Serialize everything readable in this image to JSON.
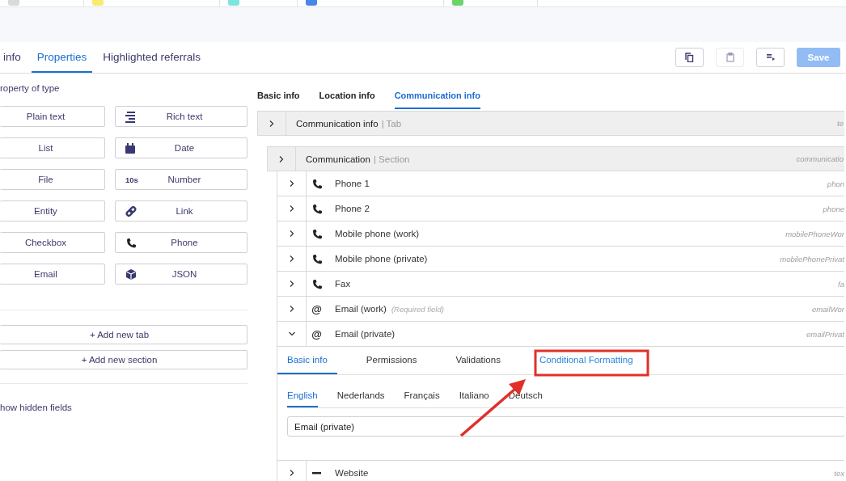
{
  "browser_tabs": [
    {
      "color": "#d9d9d9"
    },
    {
      "color": "#f7ec6e"
    },
    {
      "color": "#7fe3e0"
    },
    {
      "color": "#4a86e8"
    },
    {
      "color": "#6ad46a"
    }
  ],
  "page_tabs": [
    {
      "label": "info",
      "selected": false
    },
    {
      "label": "Properties",
      "selected": true
    },
    {
      "label": "Highlighted referrals",
      "selected": false
    }
  ],
  "toolbar": {
    "buttons": [
      {
        "kind": "copy",
        "disabled": false
      },
      {
        "kind": "paste",
        "disabled": true
      },
      {
        "kind": "format",
        "disabled": false
      }
    ],
    "save": {
      "label": "Save",
      "disabled": true
    }
  },
  "left_panel": {
    "heading": "roperty of type",
    "property_types": [
      {
        "label": "Plain text"
      },
      {
        "label": "Rich text",
        "kind": "lines"
      },
      {
        "label": "List"
      },
      {
        "label": "Date",
        "kind": "calendar"
      },
      {
        "label": "File"
      },
      {
        "label": "Number",
        "icon_text": "10s"
      },
      {
        "label": "Entity"
      },
      {
        "label": "Link",
        "kind": "link"
      },
      {
        "label": "Checkbox"
      },
      {
        "label": "Phone",
        "kind": "phone"
      },
      {
        "label": "Email"
      },
      {
        "label": "JSON",
        "kind": "cube"
      }
    ],
    "add_buttons": [
      "+ Add new tab",
      "+ Add new section"
    ],
    "show_hidden": "how hidden fields"
  },
  "editor": {
    "tabs": [
      {
        "label": "Basic info",
        "selected": false
      },
      {
        "label": "Location info",
        "selected": false
      },
      {
        "label": "Communication info",
        "selected": true
      }
    ],
    "tab_row": {
      "title": "Communication info",
      "type": "| Tab",
      "key": "te",
      "expanded": false
    },
    "section": {
      "title": "Communication",
      "type": "| Section",
      "key": "communicatio",
      "expanded": false
    },
    "fields": [
      {
        "label": "Phone 1",
        "kind": "phone",
        "key": "phon",
        "expanded": false
      },
      {
        "label": "Phone 2",
        "kind": "phone",
        "key": "phone",
        "expanded": false
      },
      {
        "label": "Mobile phone (work)",
        "kind": "phone",
        "key": "mobilePhoneWor",
        "expanded": false
      },
      {
        "label": "Mobile phone (private)",
        "kind": "phone",
        "key": "mobilePhonePrivat",
        "expanded": false
      },
      {
        "label": "Fax",
        "kind": "phone",
        "key": "fa",
        "expanded": false
      },
      {
        "label": "Email (work)",
        "icon_glyph": "@",
        "note": "(Required field)",
        "key": "emailWor",
        "expanded": false
      },
      {
        "label": "Email (private)",
        "icon_glyph": "@",
        "key": "emailPrivat",
        "expanded": true,
        "detail": {
          "tabs": [
            {
              "label": "Basic info",
              "selected": true
            },
            {
              "label": "Permissions",
              "selected": false
            },
            {
              "label": "Validations",
              "selected": false
            },
            {
              "label": "Conditional Formatting",
              "selected": false,
              "highlighted": true
            }
          ],
          "languages": [
            {
              "label": "English",
              "selected": true
            },
            {
              "label": "Nederlands",
              "selected": false
            },
            {
              "label": "Français",
              "selected": false
            },
            {
              "label": "Italiano",
              "selected": false
            },
            {
              "label": "Deutsch",
              "selected": false
            }
          ],
          "value": "Email (private)"
        }
      },
      {
        "label": "Website",
        "kind": "dash",
        "key": "tex",
        "expanded": false
      }
    ]
  }
}
